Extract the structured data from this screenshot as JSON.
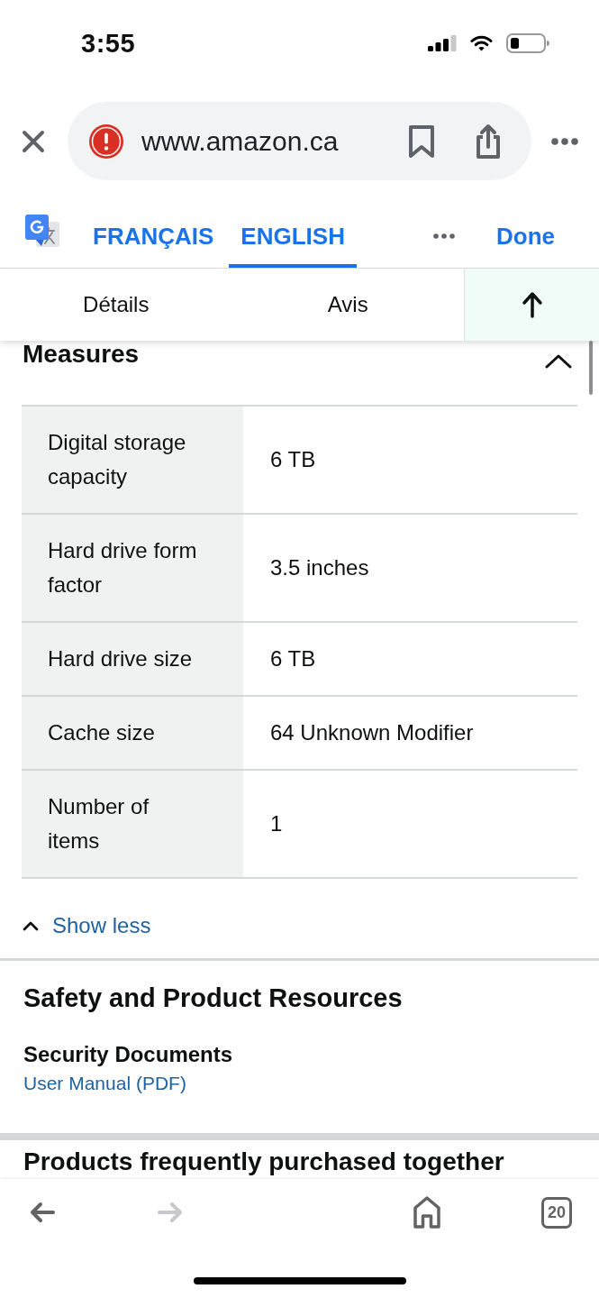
{
  "status_bar": {
    "time": "3:55"
  },
  "browser_bar": {
    "url": "www.amazon.ca"
  },
  "translate_bar": {
    "languages": [
      {
        "label": "FRANÇAIS",
        "selected": false
      },
      {
        "label": "ENGLISH",
        "selected": true
      }
    ],
    "done": "Done"
  },
  "page_tabs": [
    {
      "label": "Détails"
    },
    {
      "label": "Avis"
    }
  ],
  "measures": {
    "title": "Measures",
    "expanded": true,
    "rows": [
      {
        "label": "Digital storage capacity",
        "value": "6 TB"
      },
      {
        "label": "Hard drive form factor",
        "value": "3.5 inches"
      },
      {
        "label": "Hard drive size",
        "value": "6 TB"
      },
      {
        "label": "Cache size",
        "value": "64 Unknown Modifier"
      },
      {
        "label": "Number of items",
        "value": "1"
      }
    ],
    "toggle": "Show less"
  },
  "safety": {
    "title": "Safety and Product Resources",
    "documents_heading": "Security Documents",
    "link": "User Manual (PDF)"
  },
  "next_section": {
    "title": "Products frequently purchased together"
  },
  "bottom_bar": {
    "back": {
      "disabled": false
    },
    "forward": {
      "disabled": true
    },
    "tab_count": "20"
  }
}
